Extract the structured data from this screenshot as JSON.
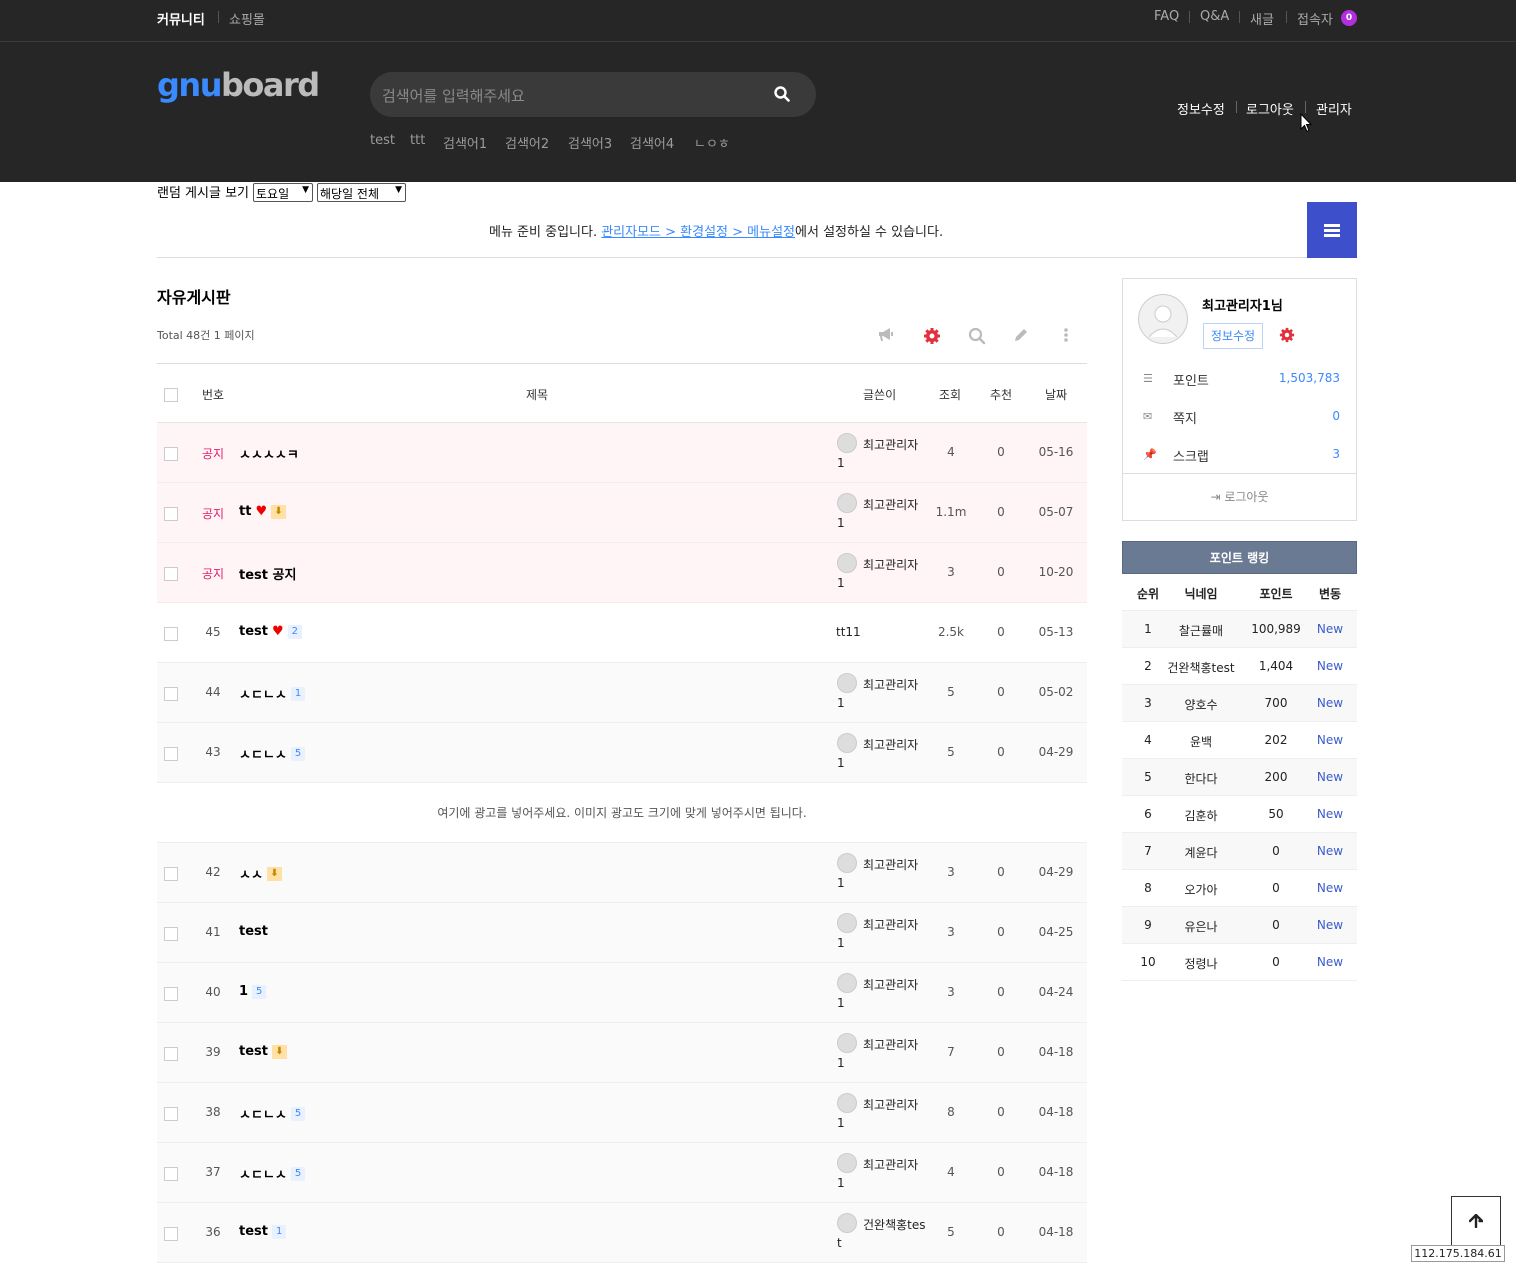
{
  "top_nav": {
    "community": "커뮤니티",
    "shop": "쇼핑몰",
    "faq": "FAQ",
    "qa": "Q&A",
    "new": "새글",
    "visitors": "접속자",
    "visitor_count": "0"
  },
  "logo": {
    "gnu": "gnu",
    "board": "board"
  },
  "search": {
    "placeholder": "검색어를 입력해주세요"
  },
  "popular": [
    "test",
    "ttt",
    "검색어1",
    "검색어2",
    "검색어3",
    "검색어4",
    "ㄴㅇㅎ"
  ],
  "user_menu": {
    "edit": "정보수정",
    "logout": "로그아웃",
    "admin": "관리자"
  },
  "random": {
    "label": "랜덤 게시글 보기",
    "day": "토요일",
    "month": "해당일 전체"
  },
  "menu_msg": {
    "pre": "메뉴 준비 중입니다. ",
    "link": "관리자모드 > 환경설정 > 메뉴설정",
    "post": "에서 설정하실 수 있습니다."
  },
  "board": {
    "title": "자유게시판",
    "total": "Total 48건 1 페이지"
  },
  "columns": {
    "num": "번호",
    "subject": "제목",
    "writer": "글쓴이",
    "views": "조회",
    "recommend": "추천",
    "date": "날짜"
  },
  "rows": [
    {
      "num": "공지",
      "subject": "ㅅㅅㅅㅅㅋ",
      "writer_a": "최고관리자",
      "writer_b": "1",
      "views": "4",
      "rec": "0",
      "date": "05-16"
    },
    {
      "num": "공지",
      "subject": "tt",
      "writer_a": "최고관리자",
      "writer_b": "1",
      "views": "1.1m",
      "rec": "0",
      "date": "05-07"
    },
    {
      "num": "공지",
      "subject": "test 공지",
      "writer_a": "최고관리자",
      "writer_b": "1",
      "views": "3",
      "rec": "0",
      "date": "10-20"
    },
    {
      "num": "45",
      "subject": "test",
      "comments": "2",
      "writer": "tt11",
      "views": "2.5k",
      "rec": "0",
      "date": "05-13"
    },
    {
      "num": "44",
      "subject": "ㅅㄷㄴㅅ",
      "comments": "1",
      "writer_a": "최고관리자",
      "writer_b": "1",
      "views": "5",
      "rec": "0",
      "date": "05-02"
    },
    {
      "num": "43",
      "subject": "ㅅㄷㄴㅅ",
      "comments": "5",
      "writer_a": "최고관리자",
      "writer_b": "1",
      "views": "5",
      "rec": "0",
      "date": "04-29"
    },
    {
      "num": "42",
      "subject": "ㅅㅅ",
      "writer_a": "최고관리자",
      "writer_b": "1",
      "views": "3",
      "rec": "0",
      "date": "04-29"
    },
    {
      "num": "41",
      "subject": "test",
      "writer_a": "최고관리자",
      "writer_b": "1",
      "views": "3",
      "rec": "0",
      "date": "04-25"
    },
    {
      "num": "40",
      "subject": "1",
      "comments": "5",
      "writer_a": "최고관리자",
      "writer_b": "1",
      "views": "3",
      "rec": "0",
      "date": "04-24"
    },
    {
      "num": "39",
      "subject": "test",
      "writer_a": "최고관리자",
      "writer_b": "1",
      "views": "7",
      "rec": "0",
      "date": "04-18"
    },
    {
      "num": "38",
      "subject": "ㅅㄷㄴㅅ",
      "comments": "5",
      "writer_a": "최고관리자",
      "writer_b": "1",
      "views": "8",
      "rec": "0",
      "date": "04-18"
    },
    {
      "num": "37",
      "subject": "ㅅㄷㄴㅅ",
      "comments": "5",
      "writer_a": "최고관리자",
      "writer_b": "1",
      "views": "4",
      "rec": "0",
      "date": "04-18"
    },
    {
      "num": "36",
      "subject": "test",
      "comments": "1",
      "writer_a": "건완책홍tes",
      "writer_b": "t",
      "views": "5",
      "rec": "0",
      "date": "04-18"
    }
  ],
  "ad_text": "여기에 광고를 넣어주세요. 이미지 광고도 크기에 맞게 넣어주시면 됩니다.",
  "profile": {
    "name": "최고관리자1님",
    "edit": "정보수정",
    "point_label": "포인트",
    "point": "1,503,783",
    "memo_label": "쪽지",
    "memo": "0",
    "scrap_label": "스크랩",
    "scrap": "3",
    "logout": "로그아웃"
  },
  "ranking": {
    "title": "포인트 랭킹",
    "headers": {
      "rank": "순위",
      "nick": "닉네임",
      "point": "포인트",
      "change": "변동"
    },
    "rows": [
      {
        "rank": "1",
        "nick": "찰근률매",
        "point": "100,989",
        "change": "New"
      },
      {
        "rank": "2",
        "nick": "건완책홍test",
        "point": "1,404",
        "change": "New"
      },
      {
        "rank": "3",
        "nick": "양호수",
        "point": "700",
        "change": "New"
      },
      {
        "rank": "4",
        "nick": "윤백",
        "point": "202",
        "change": "New"
      },
      {
        "rank": "5",
        "nick": "한다다",
        "point": "200",
        "change": "New"
      },
      {
        "rank": "6",
        "nick": "김훈하",
        "point": "50",
        "change": "New"
      },
      {
        "rank": "7",
        "nick": "계윤다",
        "point": "0",
        "change": "New"
      },
      {
        "rank": "8",
        "nick": "오가아",
        "point": "0",
        "change": "New"
      },
      {
        "rank": "9",
        "nick": "유은나",
        "point": "0",
        "change": "New"
      },
      {
        "rank": "10",
        "nick": "정령나",
        "point": "0",
        "change": "New"
      }
    ]
  },
  "ip": "112.175.184.61"
}
